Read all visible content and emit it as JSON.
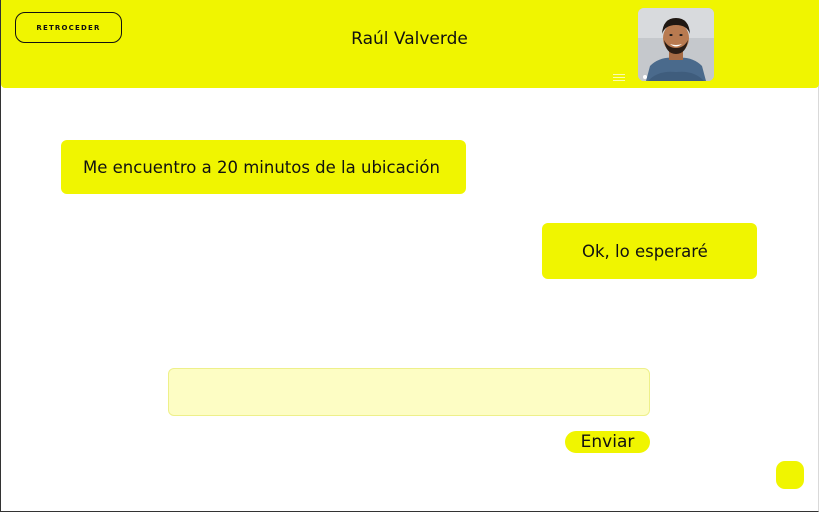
{
  "header": {
    "back_label": "RETROCEDER",
    "contact_name": "Raúl Valverde"
  },
  "messages": [
    {
      "side": "received",
      "text": "Me encuentro a 20 minutos de la ubicación"
    },
    {
      "side": "sent",
      "text": "Ok, lo esperaré"
    }
  ],
  "composer": {
    "input_value": "",
    "input_placeholder": "",
    "send_label": "Enviar"
  },
  "colors": {
    "accent": "#f0f500",
    "input_background": "#fdfdc4"
  },
  "icons": {
    "menu": "hamburger-menu-icon",
    "fab": "floating-action-button"
  }
}
